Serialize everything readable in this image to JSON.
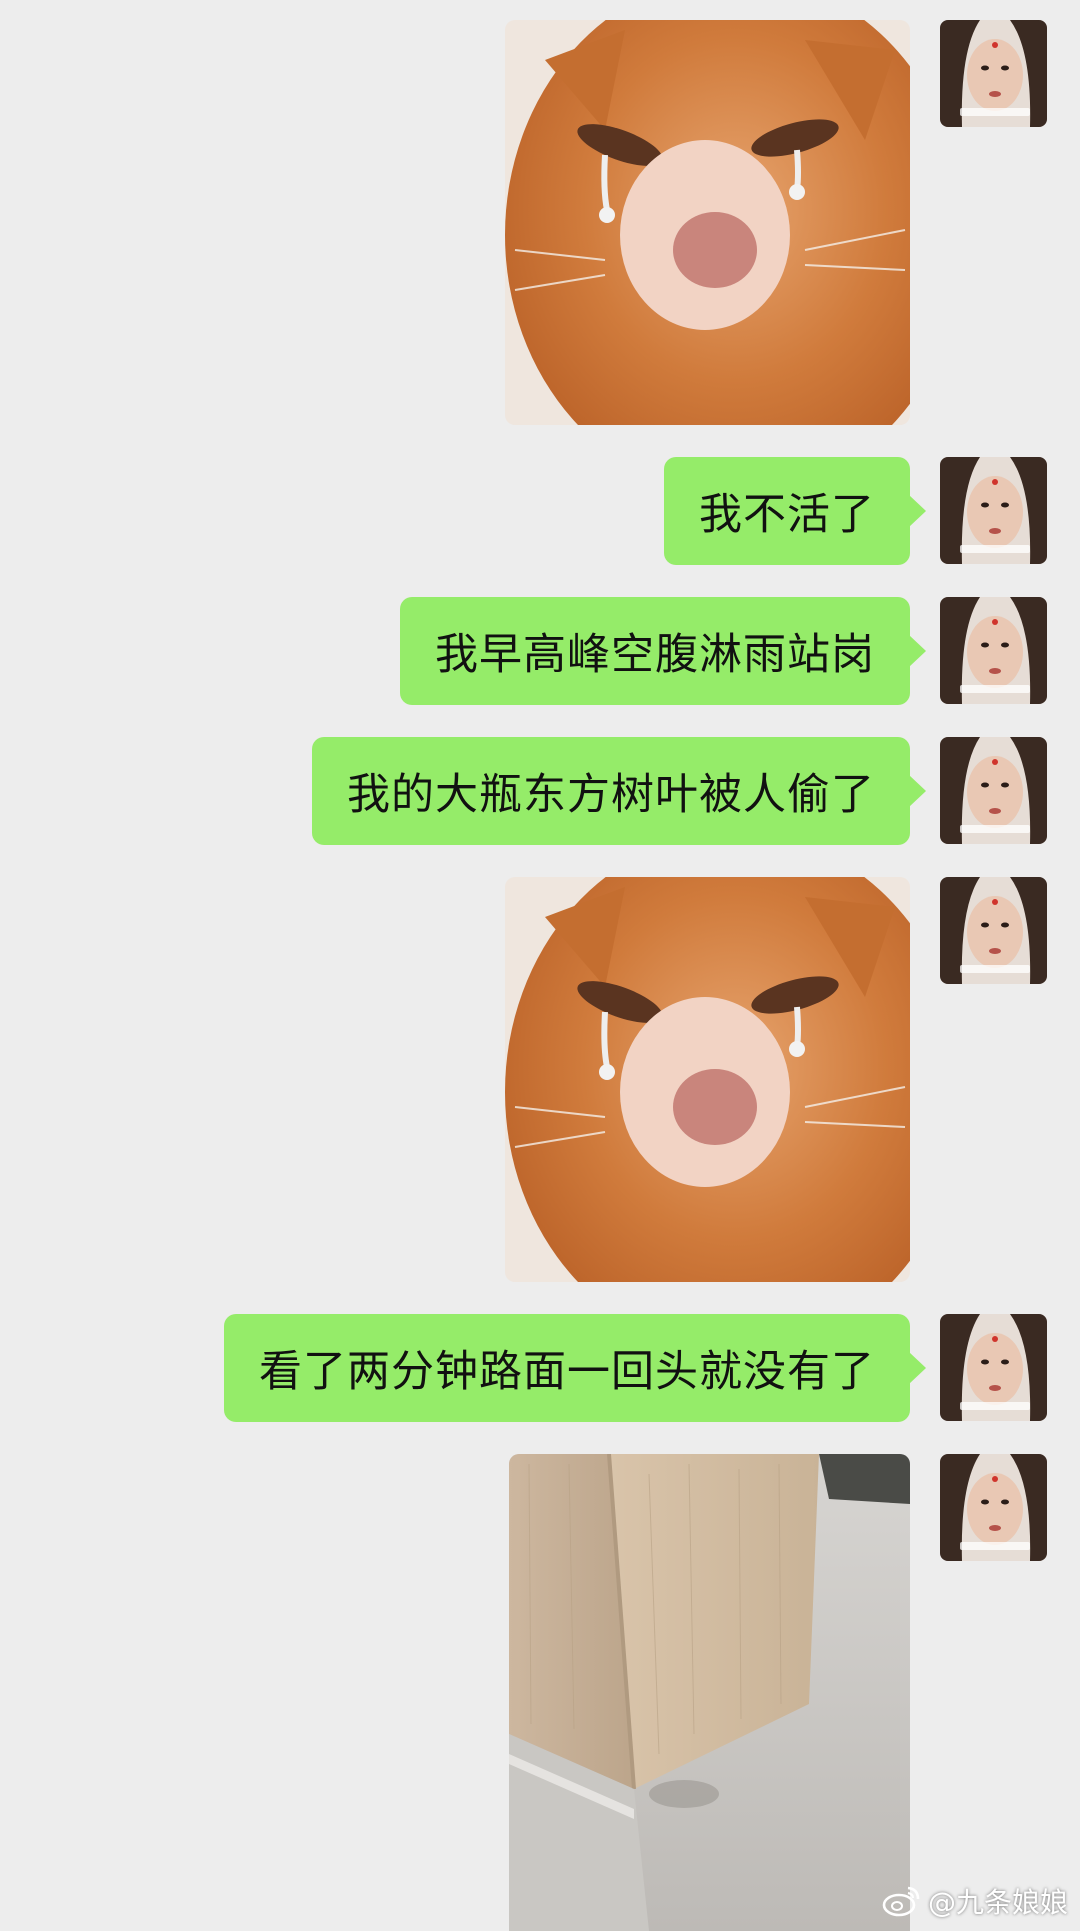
{
  "messages": [
    {
      "type": "image",
      "content": "crying-cat-sticker"
    },
    {
      "type": "text",
      "text": "我不活了"
    },
    {
      "type": "text",
      "text": "我早高峰空腹淋雨站岗"
    },
    {
      "type": "text",
      "text": "我的大瓶东方树叶被人偷了"
    },
    {
      "type": "image",
      "content": "crying-cat-sticker"
    },
    {
      "type": "text",
      "text": "看了两分钟路面一回头就没有了"
    },
    {
      "type": "image",
      "content": "wall-corner-photo"
    }
  ],
  "colors": {
    "background": "#ededed",
    "bubble_green": "#95ec69"
  },
  "watermark": {
    "icon": "weibo-icon",
    "text": "@九条娘娘"
  }
}
